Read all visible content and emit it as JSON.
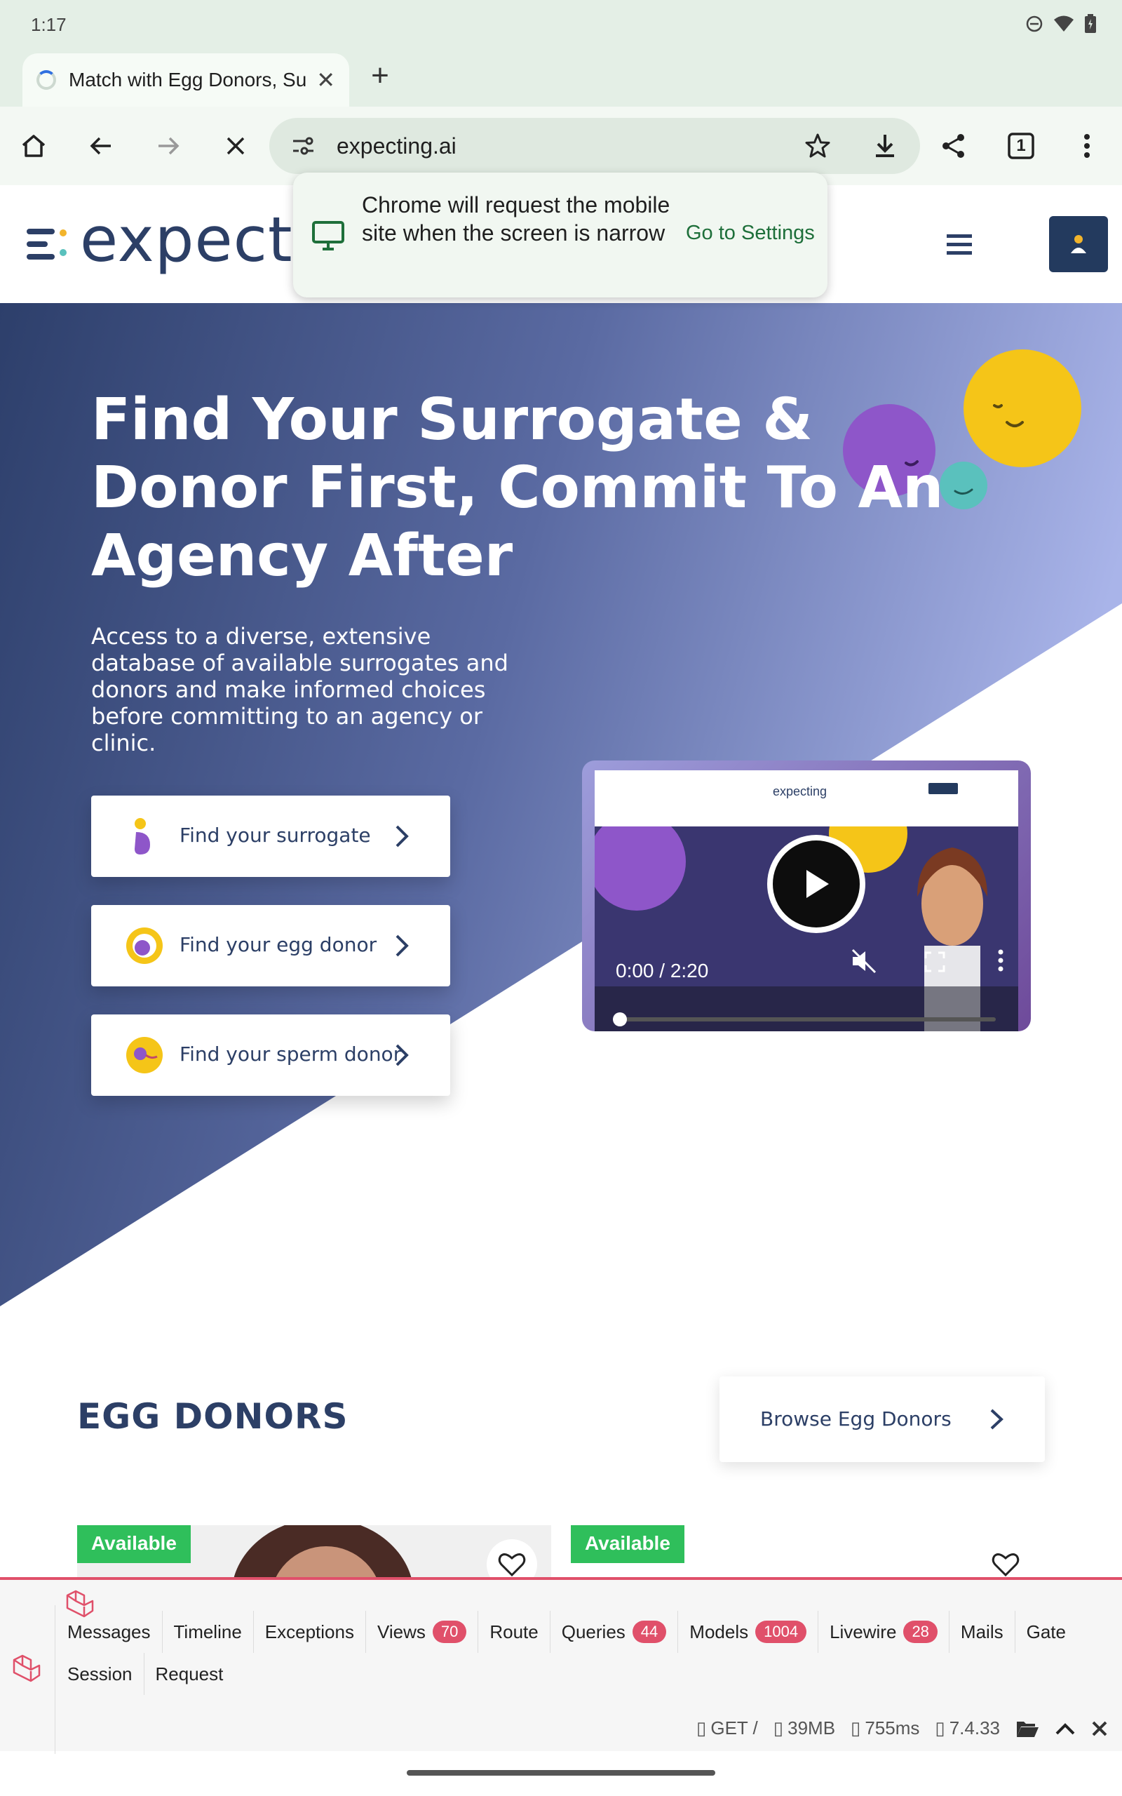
{
  "status_bar": {
    "time": "1:17"
  },
  "browser": {
    "tab_title": "Match with Egg Donors, Sur",
    "url": "expecting.ai",
    "tab_count": "1"
  },
  "popup": {
    "message": "Chrome will request the mobile site when the screen is narrow",
    "action": "Go to Settings"
  },
  "site": {
    "logo_text": "expecti",
    "hero": {
      "headline": "Find Your Surrogate & Donor First, Commit To An Agency After",
      "subtext": "Access to a diverse, extensive database of available surrogates and donors and make informed choices before committing to an agency or clinic.",
      "ctas": [
        {
          "label": "Find your surrogate"
        },
        {
          "label": "Find your egg donor"
        },
        {
          "label": "Find your sperm donor"
        }
      ],
      "video": {
        "logo": "expecting",
        "time": "0:00 / 2:20",
        "progress": 0
      }
    },
    "egg_donors": {
      "title": "EGG DONORS",
      "browse_label": "Browse Egg Donors",
      "cards": [
        {
          "badge": "Available"
        },
        {
          "badge": "Available"
        }
      ]
    }
  },
  "debugbar": {
    "tabs": [
      {
        "label": "Messages",
        "count": ""
      },
      {
        "label": "Timeline",
        "count": ""
      },
      {
        "label": "Exceptions",
        "count": ""
      },
      {
        "label": "Views",
        "count": "70"
      },
      {
        "label": "Route",
        "count": ""
      },
      {
        "label": "Queries",
        "count": "44"
      },
      {
        "label": "Models",
        "count": "1004"
      },
      {
        "label": "Livewire",
        "count": "28"
      },
      {
        "label": "Mails",
        "count": ""
      },
      {
        "label": "Gate",
        "count": ""
      },
      {
        "label": "Session",
        "count": ""
      },
      {
        "label": "Request",
        "count": ""
      }
    ],
    "status": {
      "method": "GET /",
      "memory": "39MB",
      "time": "755ms",
      "php": "7.4.33"
    }
  },
  "colors": {
    "brand_navy": "#2c3f66",
    "badge_green": "#2fbf5b",
    "debug_accent": "#e0506a",
    "link_green": "#1e6f3a"
  }
}
